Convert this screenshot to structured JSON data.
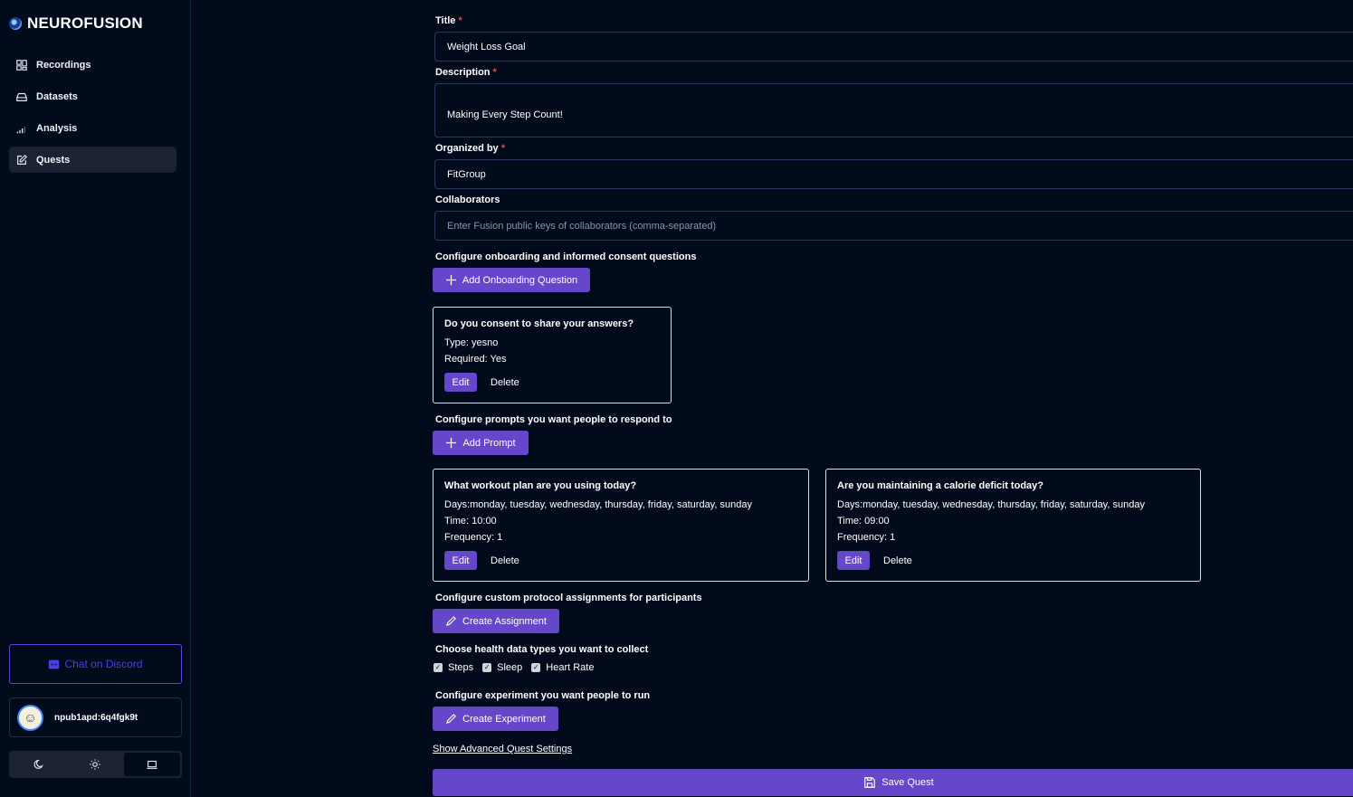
{
  "app": {
    "name": "NEUROFUSION"
  },
  "sidebar": {
    "items": [
      {
        "label": "Recordings",
        "icon": "grid-icon"
      },
      {
        "label": "Datasets",
        "icon": "database-icon"
      },
      {
        "label": "Analysis",
        "icon": "signal-icon"
      },
      {
        "label": "Quests",
        "icon": "edit-icon",
        "active": true
      }
    ],
    "discord_label": "Chat on Discord",
    "user_key": "npub1apd:6q4fgk9t",
    "theme_options": [
      "dark",
      "light",
      "system"
    ],
    "active_theme": "system"
  },
  "form": {
    "title_label": "Title",
    "title_value": "Weight Loss Goal",
    "description_label": "Description",
    "description_value": "Making Every Step Count!",
    "organized_label": "Organized by",
    "organized_value": "FitGroup",
    "collaborators_label": "Collaborators",
    "collaborators_placeholder": "Enter Fusion public keys of collaborators (comma-separated)",
    "required_mark": "*",
    "onboarding_heading": "Configure onboarding and informed consent questions",
    "add_onboarding_label": "Add Onboarding Question",
    "onboarding_card": {
      "title": "Do you consent to share your answers?",
      "type_line": "Type: yesno",
      "required_line": "Required: Yes"
    },
    "edit_label": "Edit",
    "delete_label": "Delete",
    "prompts_heading": "Configure prompts you want people to respond to",
    "add_prompt_label": "Add Prompt",
    "prompts": [
      {
        "title": "What workout plan are you using today?",
        "days": "Days:monday, tuesday, wednesday, thursday, friday, saturday, sunday",
        "time": "Time: 10:00",
        "frequency": "Frequency: 1"
      },
      {
        "title": "Are you maintaining a calorie deficit today?",
        "days": "Days:monday, tuesday, wednesday, thursday, friday, saturday, sunday",
        "time": "Time: 09:00",
        "frequency": "Frequency: 1"
      }
    ],
    "assignments_heading": "Configure custom protocol assignments for participants",
    "create_assignment_label": "Create Assignment",
    "health_heading": "Choose health data types you want to collect",
    "health_types": [
      "Steps",
      "Sleep",
      "Heart Rate"
    ],
    "experiment_heading": "Configure experiment you want people to run",
    "create_experiment_label": "Create Experiment",
    "advanced_link": "Show Advanced Quest Settings",
    "save_label": "Save Quest"
  },
  "colors": {
    "background": "#020b1c",
    "accent": "#6547c9",
    "required": "#ef4444",
    "discord": "#4d3fe0"
  }
}
